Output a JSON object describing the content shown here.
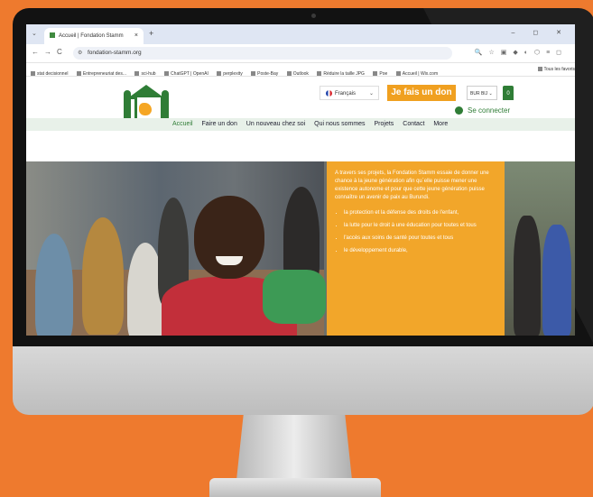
{
  "browser": {
    "tab_title": "Accueil | Fondation Stamm",
    "tab_close": "×",
    "new_tab": "+",
    "window_controls": "–  ◻  ✕",
    "url": "fondation-stamm.org",
    "nav": {
      "back": "←",
      "forward": "→",
      "reload": "C"
    },
    "bookmarks": [
      "stat decisionnel",
      "Entrepreneuriat des...",
      "sci-hub",
      "ChatGPT | OpenAI",
      "perplexity",
      "Poste-Bay",
      "Outlook",
      "Réduire la taille JPG",
      "Poe",
      "Accueil | Wix.com"
    ],
    "all_bookmarks": "Tous les favoris"
  },
  "site": {
    "language": "Français",
    "donate_label": "Je fais un don",
    "currency": "BUR BIJ",
    "cart_count": "0",
    "login_label": "Se connecter",
    "menu": [
      "Accueil",
      "Faire un don",
      "Un nouveau chez soi",
      "Qui nous sommes",
      "Projets",
      "Contact",
      "More"
    ],
    "hero": {
      "intro": "A travers ses projets, la Fondation Stamm essaie de donner une chance à la jeune génération afin qu`elle puisse mener une existence autonome et pour que cette jeune génération puisse connaître un avenir de paix au Burundi.",
      "bullets": [
        "la protection et la défense des droits de l'enfant,",
        "la lutte pour le droit à une éducation pour toutes et tous",
        "l'accès aux soins de santé pour toutes et tous",
        "le développement durable,"
      ]
    }
  },
  "colors": {
    "accent_orange": "#F0A020",
    "brand_green": "#2F7D36",
    "background": "#EE7A2E"
  }
}
